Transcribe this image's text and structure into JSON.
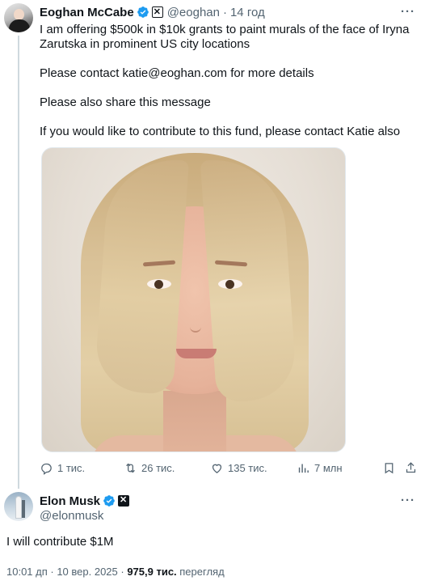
{
  "original_tweet": {
    "author_name": "Eoghan McCabe",
    "author_handle": "@eoghan",
    "time": "14 год",
    "separator": "·",
    "text_paragraphs": [
      "I am offering $500k in $10k grants to paint murals of the face of Iryna Zarutska in prominent US city locations",
      "Please contact katie@eoghan.com for more details",
      "Please also share this message",
      "If you would like to contribute to this fund, please contact Katie also"
    ],
    "actions": {
      "replies": "1 тис.",
      "reposts": "26 тис.",
      "likes": "135 тис.",
      "views": "7 млн"
    }
  },
  "reply": {
    "author_name": "Elon Musk",
    "author_handle": "@elonmusk",
    "text": "I will contribute $1M",
    "timestamp": "10:01 дп · 10 вер. 2025 · ",
    "views_count": "975,9 тис.",
    "views_label": " перегляд"
  },
  "icons": {
    "more": "more-icon",
    "verified": "verified-badge-icon",
    "reply": "reply-icon",
    "repost": "repost-icon",
    "like": "heart-icon",
    "views": "views-chart-icon",
    "bookmark": "bookmark-icon",
    "share": "share-icon"
  },
  "colors": {
    "verified_blue": "#1d9bf0",
    "text_primary": "#0f1419",
    "text_secondary": "#536471",
    "divider": "#cfd9de"
  }
}
